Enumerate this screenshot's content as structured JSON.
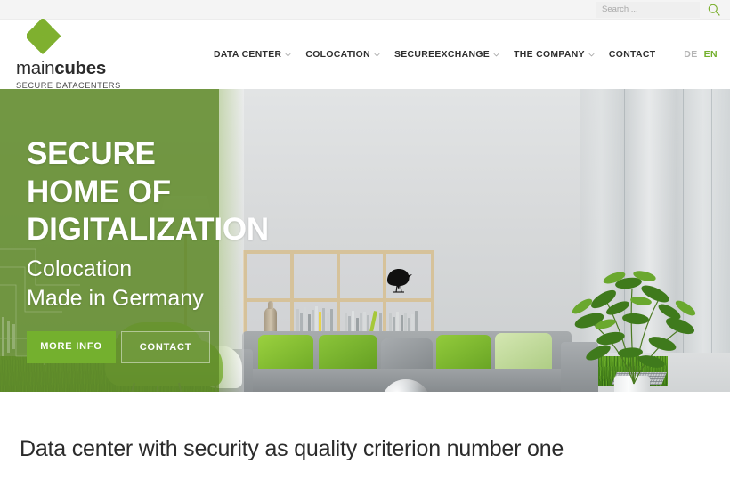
{
  "topbar": {
    "search": {
      "placeholder": "Search ...",
      "value": "",
      "icon": "search-icon"
    }
  },
  "header": {
    "logo": {
      "mark": "cubes-diamond-logo-icon",
      "word_light": "main",
      "word_bold": "cubes",
      "tagline": "SECURE DATACENTERS"
    },
    "nav": [
      {
        "label": "DATA CENTER",
        "has_dropdown": true
      },
      {
        "label": "COLOCATION",
        "has_dropdown": true
      },
      {
        "label": "SECUREEXCHANGE",
        "has_dropdown": true
      },
      {
        "label": "THE COMPANY",
        "has_dropdown": true
      },
      {
        "label": "CONTACT",
        "has_dropdown": false
      }
    ],
    "languages": [
      {
        "code": "DE",
        "active": false
      },
      {
        "code": "EN",
        "active": true
      }
    ]
  },
  "hero": {
    "headline_lines": [
      "SECURE",
      "HOME OF",
      "DIGITALIZATION"
    ],
    "subline_lines": [
      "Colocation",
      "Made in Germany"
    ],
    "buttons": [
      {
        "label": "MORE INFO",
        "style": "primary"
      },
      {
        "label": "CONTACT",
        "style": "ghost"
      }
    ],
    "scene_description": "modern living room with grey sofa, green pillows, bookshelf, plant and data centre racks"
  },
  "content": {
    "section_title": "Data center with security as quality criterion number one"
  },
  "colors": {
    "brand_green": "#74b02e",
    "overlay_green": "#628c2c",
    "logo_green": "#7fb02f",
    "topbar_grey": "#f4f4f4",
    "text_dark": "#2b2b2b",
    "lang_inactive": "#b4b4b4"
  }
}
